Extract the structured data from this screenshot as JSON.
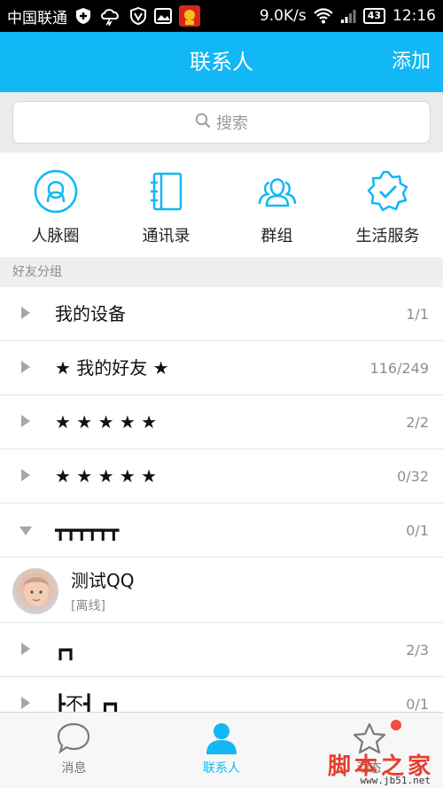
{
  "status_bar": {
    "carrier": "中国联通",
    "net_speed": "9.0K/s",
    "battery": "43",
    "time": "12:16"
  },
  "header": {
    "title": "联系人",
    "add_label": "添加"
  },
  "search": {
    "placeholder": "搜索"
  },
  "quick_actions": [
    {
      "label": "人脉圈",
      "icon": "contacts-circle-icon"
    },
    {
      "label": "通讯录",
      "icon": "address-book-icon"
    },
    {
      "label": "群组",
      "icon": "group-icon"
    },
    {
      "label": "生活服务",
      "icon": "life-service-icon"
    }
  ],
  "section_header": "好友分组",
  "groups": [
    {
      "name": "我的设备",
      "count": "1/1",
      "expanded": false
    },
    {
      "name": "★ 我的好友 ★",
      "count": "116/249",
      "expanded": false
    },
    {
      "name": " ★ ★ ★ ★ ★",
      "count": "2/2",
      "expanded": false
    },
    {
      "name": " ★ ★ ★ ★ ★",
      "count": "0/32",
      "expanded": false
    },
    {
      "name": "┳┳┳┳┳┳",
      "count": "0/1",
      "expanded": true
    }
  ],
  "friend": {
    "name": "测试QQ",
    "status": "[离线]"
  },
  "groups_after": [
    {
      "name": "┏┓",
      "count": "2/3"
    },
    {
      "name": "┣不┫ ┏┓",
      "count": "0/1"
    }
  ],
  "tabs": [
    {
      "label": "消息",
      "active": false
    },
    {
      "label": "联系人",
      "active": true
    },
    {
      "label": "动态",
      "active": false
    }
  ],
  "watermark": {
    "text": "脚本之家",
    "url": "www.jb51.net"
  },
  "colors": {
    "accent": "#12b7f5",
    "badge": "#f34b3f"
  }
}
